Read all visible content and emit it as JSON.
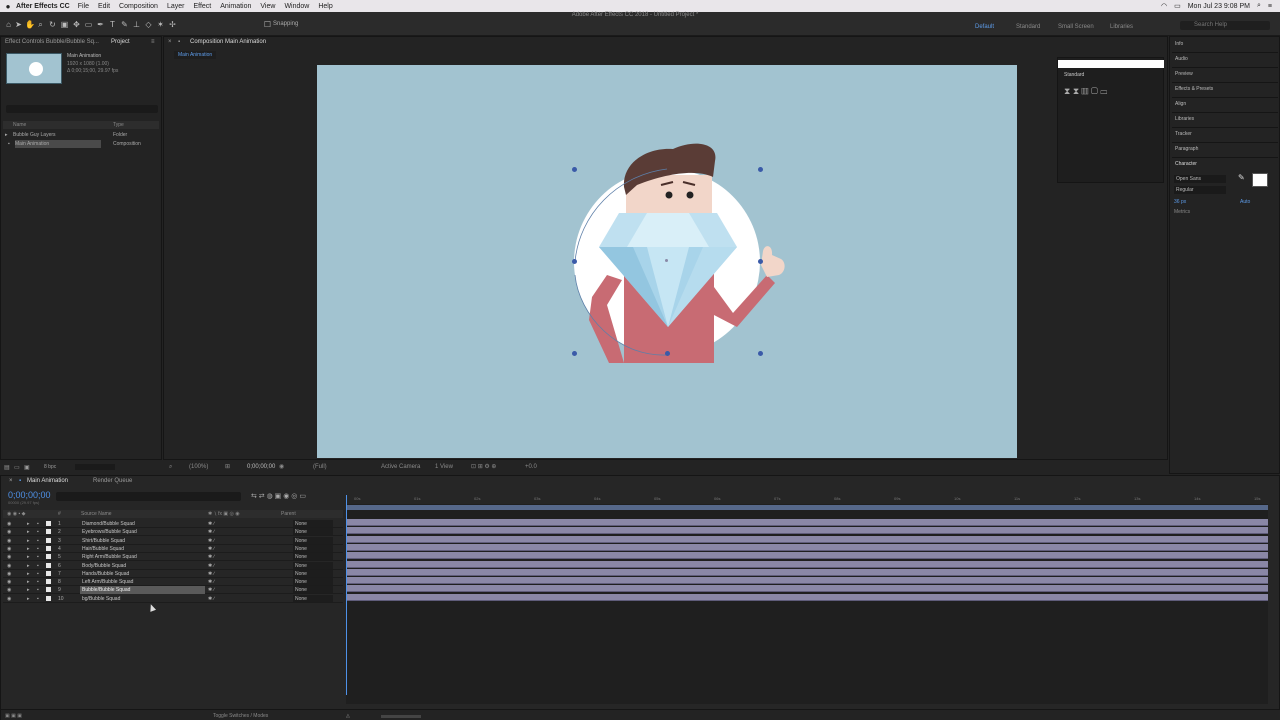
{
  "menubar": {
    "apple": "",
    "app_name": "After Effects CC",
    "menus": [
      "File",
      "Edit",
      "Composition",
      "Layer",
      "Effect",
      "Animation",
      "View",
      "Window",
      "Help"
    ],
    "clock": "Mon Jul 23  9:08 PM"
  },
  "toolbar": {
    "window_title": "Adobe After Effects CC 2018 - Untitled Project *",
    "snapping_label": "Snapping",
    "workspaces": [
      "Default",
      "Standard",
      "Small Screen",
      "Libraries"
    ],
    "active_workspace": "Default",
    "search_placeholder": "Search Help"
  },
  "project_panel": {
    "tab_effects": "Effect Controls Bubble/Bubble Sq...",
    "tab_project": "Project",
    "comp_name": "Main Animation",
    "comp_info_1": "1920 x 1080 (1.00)",
    "comp_info_2": "Δ 0;00;15;00, 29.97 fps",
    "col_name": "Name",
    "col_type": "Type",
    "items": [
      {
        "name": "Bubble Guy Layers",
        "type": "Folder"
      },
      {
        "name": "Main Animation",
        "type": "Composition"
      }
    ],
    "footer": "8 bpc"
  },
  "comp_panel": {
    "tab_label": "Composition Main Animation",
    "sub_tab": "Main Animation",
    "zoom": "(100%)",
    "timecode": "0;00;00;00",
    "resolution": "(Full)",
    "camera": "Active Camera",
    "views": "1 View",
    "offset": "+0.0"
  },
  "right_panel": {
    "items": [
      "Info",
      "Audio",
      "Preview",
      "Effects & Presets",
      "Align",
      "Libraries",
      "Tracker",
      "Paragraph",
      "Character"
    ],
    "font": "Open Sans",
    "style": "Regular",
    "size": "36 px",
    "tracking": "Metrics",
    "auto": "Auto"
  },
  "tools_panel": {
    "tab": "Standard"
  },
  "timeline": {
    "tab_main": "Main Animation",
    "tab_render": "Render Queue",
    "timecode": "0;00;00;00",
    "timecode_sub": "00000 (29.97 fps)",
    "col_source": "Source Name",
    "col_parent": "Parent",
    "footer": "Toggle Switches / Modes",
    "layers": [
      {
        "num": "1",
        "name": "Diamond/Bubble Squad",
        "parent": "None"
      },
      {
        "num": "2",
        "name": "Eyebrows/Bubble Squad",
        "parent": "None"
      },
      {
        "num": "3",
        "name": "Shirt/Bubble Squad",
        "parent": "None"
      },
      {
        "num": "4",
        "name": "Hair/Bubble Squad",
        "parent": "None"
      },
      {
        "num": "5",
        "name": "Right Arm/Bubble Squad",
        "parent": "None"
      },
      {
        "num": "6",
        "name": "Body/Bubble Squad",
        "parent": "None"
      },
      {
        "num": "7",
        "name": "Hands/Bubble Squad",
        "parent": "None"
      },
      {
        "num": "8",
        "name": "Left Arm/Bubble Squad",
        "parent": "None"
      },
      {
        "num": "9",
        "name": "Bubble/Bubble Squad",
        "parent": "None"
      },
      {
        "num": "10",
        "name": "bg/Bubble Squad",
        "parent": "None"
      }
    ],
    "ruler_marks": [
      "00s",
      "01s",
      "02s",
      "03s",
      "04s",
      "05s",
      "06s",
      "07s",
      "08s",
      "09s",
      "10s",
      "11s",
      "12s",
      "13s",
      "14s",
      "15s"
    ]
  },
  "colors": {
    "accent": "#4e91e8",
    "canvas": "#a2c3d0",
    "layer_bar": "#8a87a6"
  }
}
